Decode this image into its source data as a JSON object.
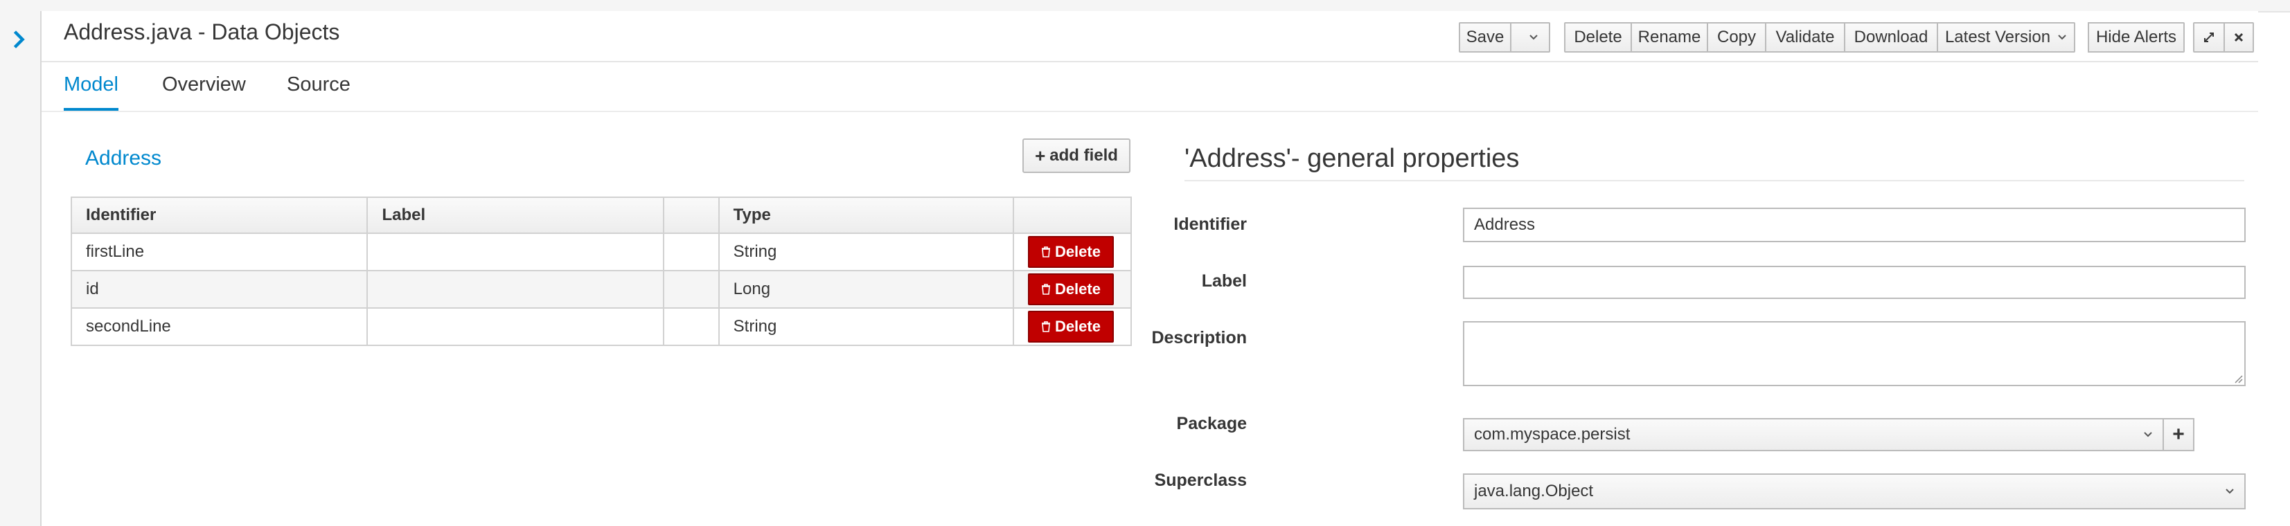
{
  "window": {
    "title": "Address.java - Data Objects"
  },
  "toolbar": {
    "save": "Save",
    "delete": "Delete",
    "rename": "Rename",
    "copy": "Copy",
    "validate": "Validate",
    "download": "Download",
    "latest_version": "Latest Version",
    "hide_alerts": "Hide Alerts"
  },
  "tabs": [
    {
      "label": "Model",
      "active": true
    },
    {
      "label": "Overview",
      "active": false
    },
    {
      "label": "Source",
      "active": false
    }
  ],
  "left": {
    "heading": "Address",
    "add_field_label": "add field",
    "columns": [
      "Identifier",
      "Label",
      "",
      "Type",
      ""
    ],
    "rows": [
      {
        "identifier": "firstLine",
        "label": "",
        "type": "String",
        "action": "Delete"
      },
      {
        "identifier": "id",
        "label": "",
        "type": "Long",
        "action": "Delete"
      },
      {
        "identifier": "secondLine",
        "label": "",
        "type": "String",
        "action": "Delete"
      }
    ]
  },
  "right": {
    "heading": "'Address'- general properties",
    "fields": {
      "identifier_label": "Identifier",
      "identifier_value": "Address",
      "label_label": "Label",
      "label_value": "",
      "description_label": "Description",
      "description_value": "",
      "package_label": "Package",
      "package_value": "com.myspace.persist",
      "superclass_label": "Superclass",
      "superclass_value": "java.lang.Object"
    }
  },
  "colors": {
    "accent": "#0088ce",
    "danger": "#c00000"
  }
}
